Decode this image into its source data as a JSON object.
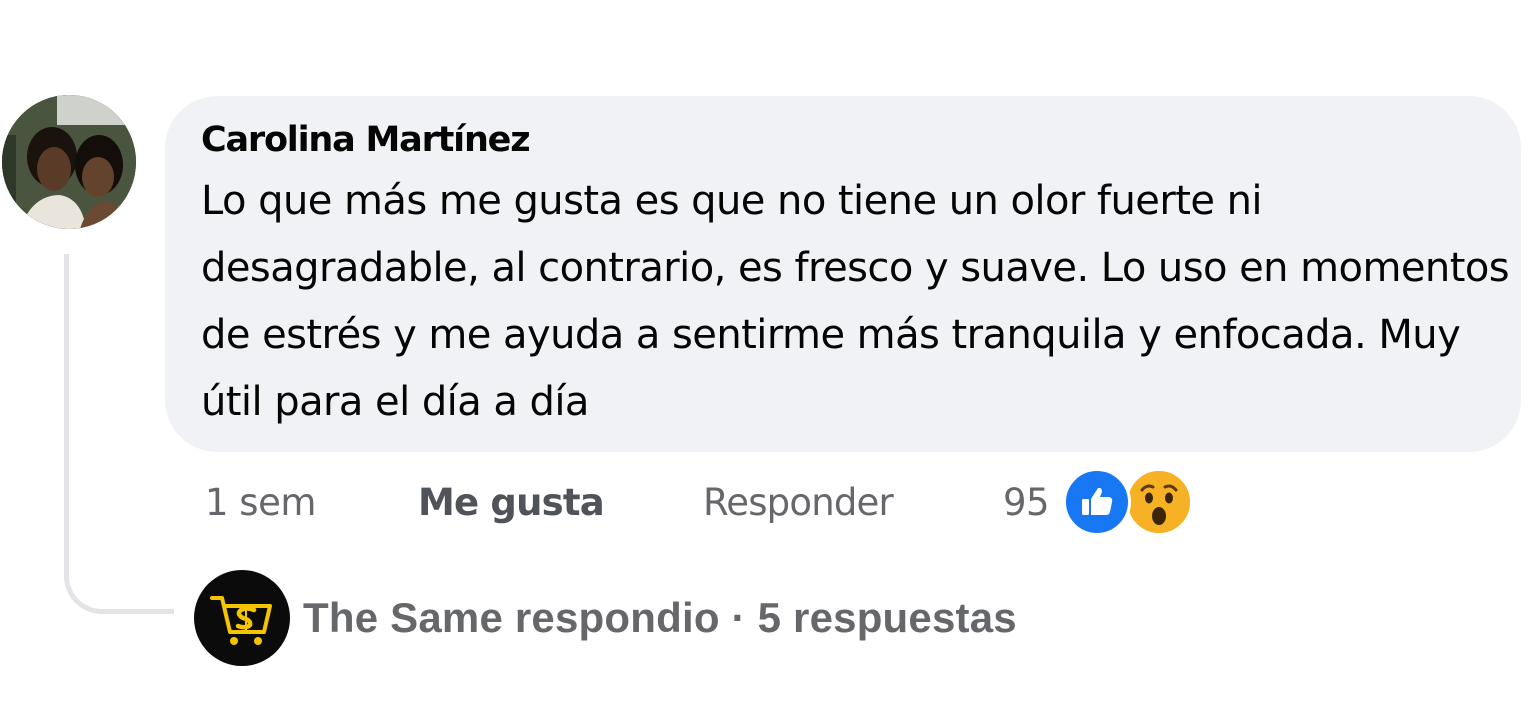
{
  "comment": {
    "author": "Carolina Martínez",
    "text": "Lo que más me gusta es que no tiene un olor fuerte ni desagradable, al contrario, es fresco y suave. Lo uso en momentos de estrés y me ayuda a sentirme más tranquila y enfocada. Muy útil para el día a día"
  },
  "actions": {
    "time": "1 sem",
    "like_label": "Me gusta",
    "reply_label": "Responder",
    "reaction_count": "95",
    "reactions": [
      "like-icon",
      "wow-icon"
    ]
  },
  "replies": {
    "summary": "The Same respondio · 5 respuestas",
    "avatar_icon": "the-same-logo-icon"
  },
  "colors": {
    "bubble_bg": "#f0f2f5",
    "secondary_text": "#65676b",
    "like_blue": "#1877f2",
    "wow_yellow": "#f7b125",
    "logo_yellow": "#f5c400"
  }
}
